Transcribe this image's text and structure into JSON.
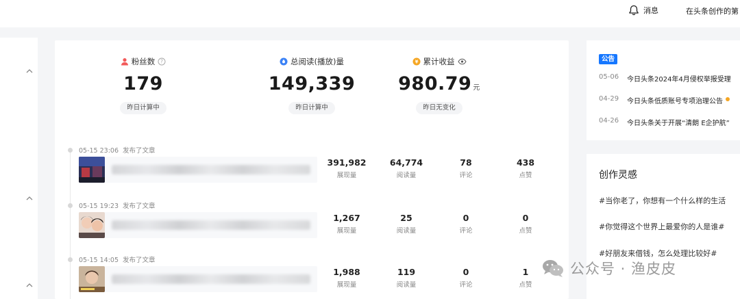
{
  "header": {
    "notify_label": "消息",
    "creator_link": "在头条创作的第"
  },
  "stats": [
    {
      "label": "粉丝数",
      "value": "179",
      "unit": "",
      "badge": "昨日计算中",
      "icon": "user-icon",
      "tail_icon": "help-icon",
      "accent": "#f25a5a"
    },
    {
      "label": "总阅读(播放)量",
      "value": "149,339",
      "unit": "",
      "badge": "昨日计算中",
      "icon": "drop-icon",
      "tail_icon": "",
      "accent": "#3b82f6"
    },
    {
      "label": "累计收益",
      "value": "980.79",
      "unit": "元",
      "badge": "昨日无变化",
      "icon": "coin-icon",
      "tail_icon": "eye-icon",
      "accent": "#f5a623"
    }
  ],
  "feed": [
    {
      "time": "05-15 23:06",
      "action": "发布了文章",
      "metrics": [
        {
          "value": "391,982",
          "label": "展现量"
        },
        {
          "value": "64,774",
          "label": "阅读量"
        },
        {
          "value": "78",
          "label": "评论"
        },
        {
          "value": "438",
          "label": "点赞"
        }
      ]
    },
    {
      "time": "05-15 19:23",
      "action": "发布了文章",
      "metrics": [
        {
          "value": "1,267",
          "label": "展现量"
        },
        {
          "value": "25",
          "label": "阅读量"
        },
        {
          "value": "0",
          "label": "评论"
        },
        {
          "value": "0",
          "label": "点赞"
        }
      ]
    },
    {
      "time": "05-15 14:05",
      "action": "发布了文章",
      "metrics": [
        {
          "value": "1,988",
          "label": "展现量"
        },
        {
          "value": "119",
          "label": "阅读量"
        },
        {
          "value": "0",
          "label": "评论"
        },
        {
          "value": "1",
          "label": "点赞"
        }
      ]
    }
  ],
  "notice": {
    "tag": "公告",
    "items": [
      {
        "date": "05-06",
        "text": "今日头条2024年4月侵权举报受理"
      },
      {
        "date": "04-29",
        "text": "今日头条低质账号专项治理公告"
      },
      {
        "date": "04-26",
        "text": "今日头条关于开展“清朗 E企护航”"
      }
    ]
  },
  "inspiration": {
    "title": "创作灵感",
    "topics": [
      "#当你老了，你想有一个什么样的生活",
      "#你觉得这个世界上最爱你的人是谁#",
      "#好朋友来借钱，怎么处理比较好#"
    ]
  },
  "watermark": "公众号 · 渔皮皮",
  "colors": {
    "accent_blue": "#1677ff",
    "text_main": "#222222",
    "text_muted": "#888888",
    "page_bg": "#f4f5f7"
  }
}
